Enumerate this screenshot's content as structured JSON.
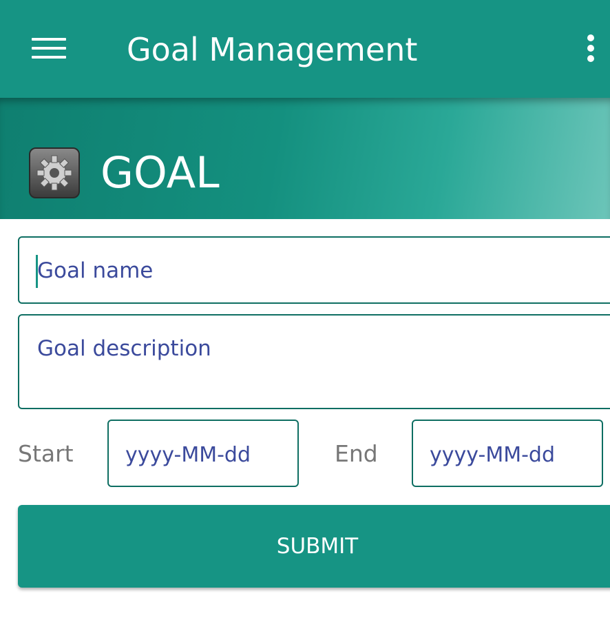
{
  "appbar": {
    "title": "Goal Management",
    "menu_icon": "hamburger-menu-icon",
    "overflow_icon": "more-vert-icon",
    "color": "#169484"
  },
  "banner": {
    "icon": "gear-icon",
    "title": "GOAL"
  },
  "form": {
    "goal_name": {
      "value": "",
      "placeholder": "Goal name"
    },
    "goal_description": {
      "value": "",
      "placeholder": "Goal description"
    },
    "start_label": "Start",
    "start_date": {
      "value": "",
      "placeholder": "yyyy-MM-dd"
    },
    "end_label": "End",
    "end_date": {
      "value": "",
      "placeholder": "yyyy-MM-dd"
    },
    "submit_label": "SUBMIT"
  },
  "colors": {
    "primary": "#169484",
    "field_border": "#0e6e62",
    "placeholder_text": "#3b4a9c",
    "label_text": "#777777"
  }
}
